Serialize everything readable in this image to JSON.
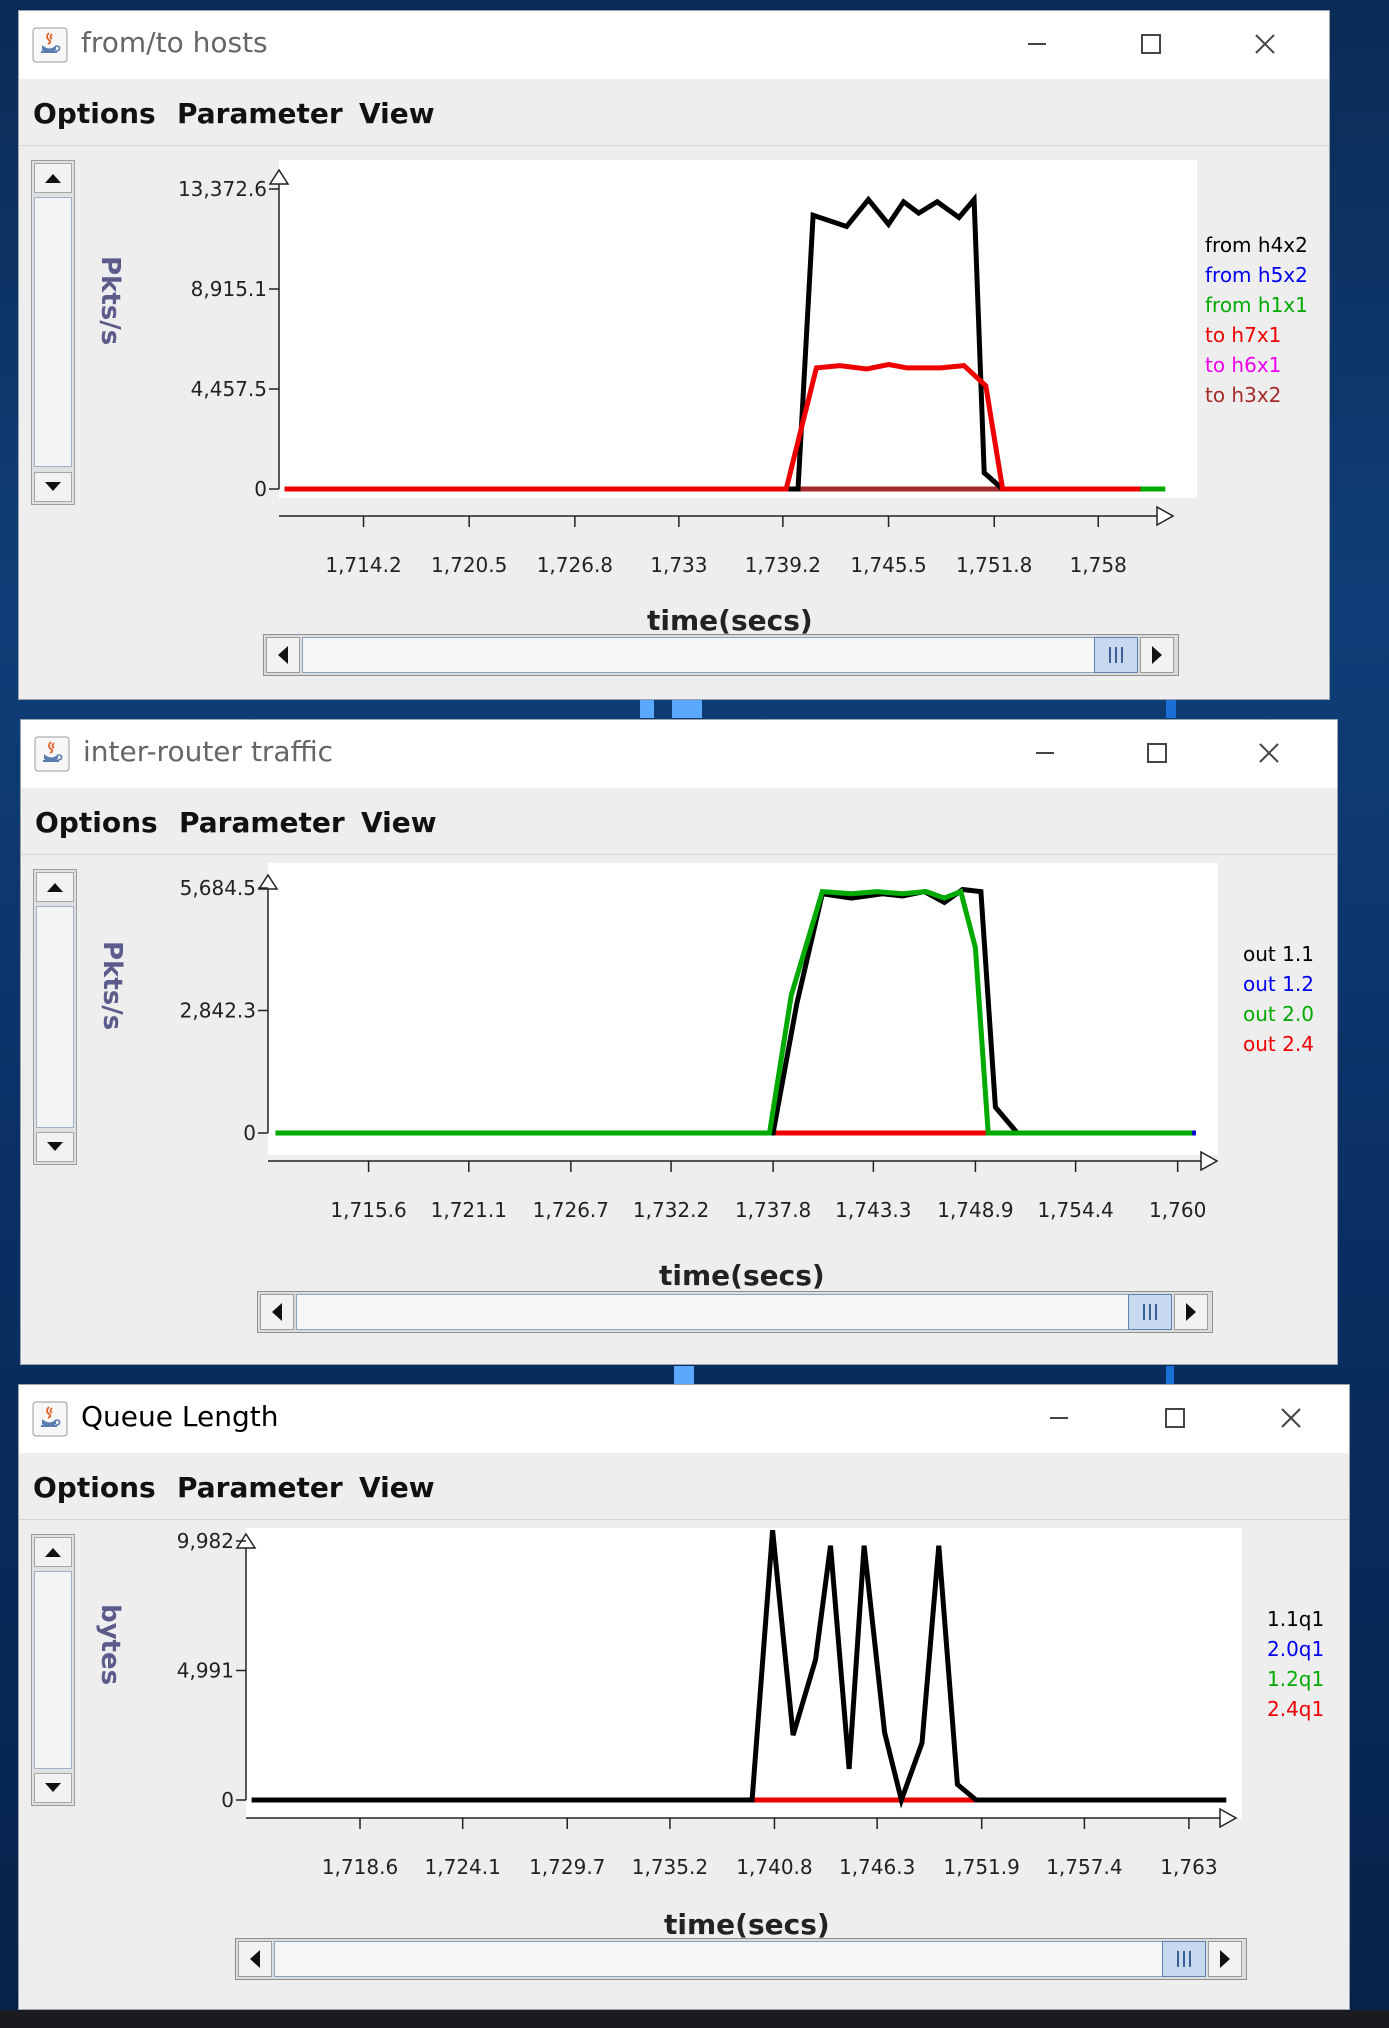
{
  "windows": [
    {
      "id": "hosts",
      "title": "from/to hosts",
      "active": false,
      "menus": [
        "Options",
        "Parameter",
        "View"
      ],
      "chart_data": {
        "type": "line",
        "ylabel": "Pkts/s",
        "xlabel": "time(secs)",
        "ylim": [
          0,
          13372.6
        ],
        "xlim": [
          1709.4,
          1762.1
        ],
        "y_ticks": [
          0,
          4457.5,
          8915.1,
          13372.6
        ],
        "y_tick_labels": [
          "0",
          "4,457.5",
          "8,915.1",
          "13,372.6"
        ],
        "x_ticks": [
          1714.2,
          1720.5,
          1726.8,
          1733,
          1739.2,
          1745.5,
          1751.8,
          1758
        ],
        "x_tick_labels": [
          "1,714.2",
          "1,720.5",
          "1,726.8",
          "1,733",
          "1,739.2",
          "1,745.5",
          "1,751.8",
          "1,758"
        ],
        "series": [
          {
            "name": "from h4x2",
            "color": "#000000",
            "x": [
              1709.5,
              1740.1,
              1741.0,
              1743.0,
              1744.3,
              1745.5,
              1746.4,
              1747.3,
              1748.4,
              1749.7,
              1750.6,
              1751.2,
              1752.3,
              1753.5,
              1760.5
            ],
            "y": [
              0,
              0,
              12200,
              11700,
              12900,
              11800,
              12800,
              12300,
              12800,
              12100,
              12900,
              720,
              0,
              0,
              0
            ]
          },
          {
            "name": "from h5x2",
            "color": "#0000ee",
            "x": [
              1709.5,
              1760.5
            ],
            "y": [
              0,
              0
            ]
          },
          {
            "name": "from h1x1",
            "color": "#00aa00",
            "x": [
              1709.5,
              1762.0
            ],
            "y": [
              0,
              0
            ]
          },
          {
            "name": "to h7x1",
            "color": "#ee0000",
            "x": [
              1709.5,
              1739.4,
              1741.2,
              1742.6,
              1744.2,
              1745.5,
              1746.6,
              1748.6,
              1750.0,
              1751.3,
              1752.3,
              1760.5
            ],
            "y": [
              0,
              0,
              5400,
              5500,
              5350,
              5550,
              5400,
              5400,
              5500,
              4600,
              0,
              0
            ]
          },
          {
            "name": "to h6x1",
            "color": "#ee00ee",
            "x": [
              1709.5,
              1760.5
            ],
            "y": [
              0,
              0
            ]
          },
          {
            "name": "to h3x2",
            "color": "#a52a2a",
            "x": [
              1709.5,
              1760.5
            ],
            "y": [
              0,
              0
            ]
          }
        ]
      },
      "scrollbar": {
        "position": 0.98
      }
    },
    {
      "id": "router",
      "title": "inter-router traffic",
      "active": false,
      "menus": [
        "Options",
        "Parameter",
        "View"
      ],
      "chart_data": {
        "type": "line",
        "ylabel": "Pkts/s",
        "xlabel": "time(secs)",
        "ylim": [
          0,
          5684.5
        ],
        "xlim": [
          1710.3,
          1761.5
        ],
        "y_ticks": [
          0,
          2842.3,
          5684.5
        ],
        "y_tick_labels": [
          "0",
          "2,842.3",
          "5,684.5"
        ],
        "x_ticks": [
          1715.6,
          1721.1,
          1726.7,
          1732.2,
          1737.8,
          1743.3,
          1748.9,
          1754.4,
          1760
        ],
        "x_tick_labels": [
          "1,715.6",
          "1,721.1",
          "1,726.7",
          "1,732.2",
          "1,737.8",
          "1,743.3",
          "1,748.9",
          "1,754.4",
          "1,760"
        ],
        "series": [
          {
            "name": "out 1.1",
            "color": "#000000",
            "x": [
              1710.5,
              1737.8,
              1739.1,
              1740.5,
              1742.1,
              1743.8,
              1744.9,
              1746.1,
              1747.2,
              1748.2,
              1749.2,
              1750.0,
              1751.2,
              1752.0,
              1760.8
            ],
            "y": [
              0,
              0,
              3000,
              5550,
              5450,
              5550,
              5500,
              5600,
              5350,
              5650,
              5600,
              600,
              0,
              0,
              0
            ]
          },
          {
            "name": "out 1.2",
            "color": "#0000ee",
            "x": [
              1710.5,
              1761.0
            ],
            "y": [
              0,
              0
            ]
          },
          {
            "name": "out 2.0",
            "color": "#00aa00",
            "x": [
              1710.5,
              1737.6,
              1738.8,
              1740.5,
              1742.1,
              1743.5,
              1744.9,
              1746.2,
              1747.2,
              1748.1,
              1748.9,
              1749.6,
              1760.8
            ],
            "y": [
              0,
              0,
              3200,
              5600,
              5550,
              5600,
              5550,
              5600,
              5450,
              5600,
              4300,
              0,
              0
            ]
          },
          {
            "name": "out 2.4",
            "color": "#ee0000",
            "x": [
              1710.5,
              1760.8
            ],
            "y": [
              0,
              0
            ]
          }
        ]
      },
      "scrollbar": {
        "position": 0.98
      }
    },
    {
      "id": "queue",
      "title": "Queue Length",
      "active": true,
      "menus": [
        "Options",
        "Parameter",
        "View"
      ],
      "chart_data": {
        "type": "line",
        "ylabel": "bytes",
        "xlabel": "time(secs)",
        "ylim": [
          0,
          9982
        ],
        "xlim": [
          1712.6,
          1765.2
        ],
        "y_ticks": [
          0,
          4991,
          9982
        ],
        "y_tick_labels": [
          "0",
          "4,991",
          "9,982"
        ],
        "x_ticks": [
          1718.6,
          1724.1,
          1729.7,
          1735.2,
          1740.8,
          1746.3,
          1751.9,
          1757.4,
          1763
        ],
        "x_tick_labels": [
          "1,718.6",
          "1,724.1",
          "1,729.7",
          "1,735.2",
          "1,740.8",
          "1,746.3",
          "1,751.9",
          "1,757.4",
          "1,763"
        ],
        "series": [
          {
            "name": "1.1q1",
            "color": "#000000",
            "x": [
              1712.8,
              1739.6,
              1740.7,
              1741.8,
              1743.0,
              1743.8,
              1744.8,
              1745.6,
              1746.7,
              1747.6,
              1748.7,
              1749.6,
              1750.6,
              1751.6,
              1765.0
            ],
            "y": [
              0,
              0,
              10400,
              2500,
              5400,
              9800,
              1200,
              9800,
              2600,
              0,
              2200,
              9800,
              600,
              0,
              0
            ]
          },
          {
            "name": "2.0q1",
            "color": "#0000ee",
            "x": [
              1712.8,
              1764.0
            ],
            "y": [
              0,
              0
            ]
          },
          {
            "name": "1.2q1",
            "color": "#00aa00",
            "x": [
              1712.8,
              1764.0
            ],
            "y": [
              0,
              0
            ]
          },
          {
            "name": "2.4q1",
            "color": "#ee0000",
            "x": [
              1712.8,
              1763.6
            ],
            "y": [
              0,
              0
            ]
          }
        ]
      },
      "scrollbar": {
        "position": 0.98
      }
    }
  ]
}
